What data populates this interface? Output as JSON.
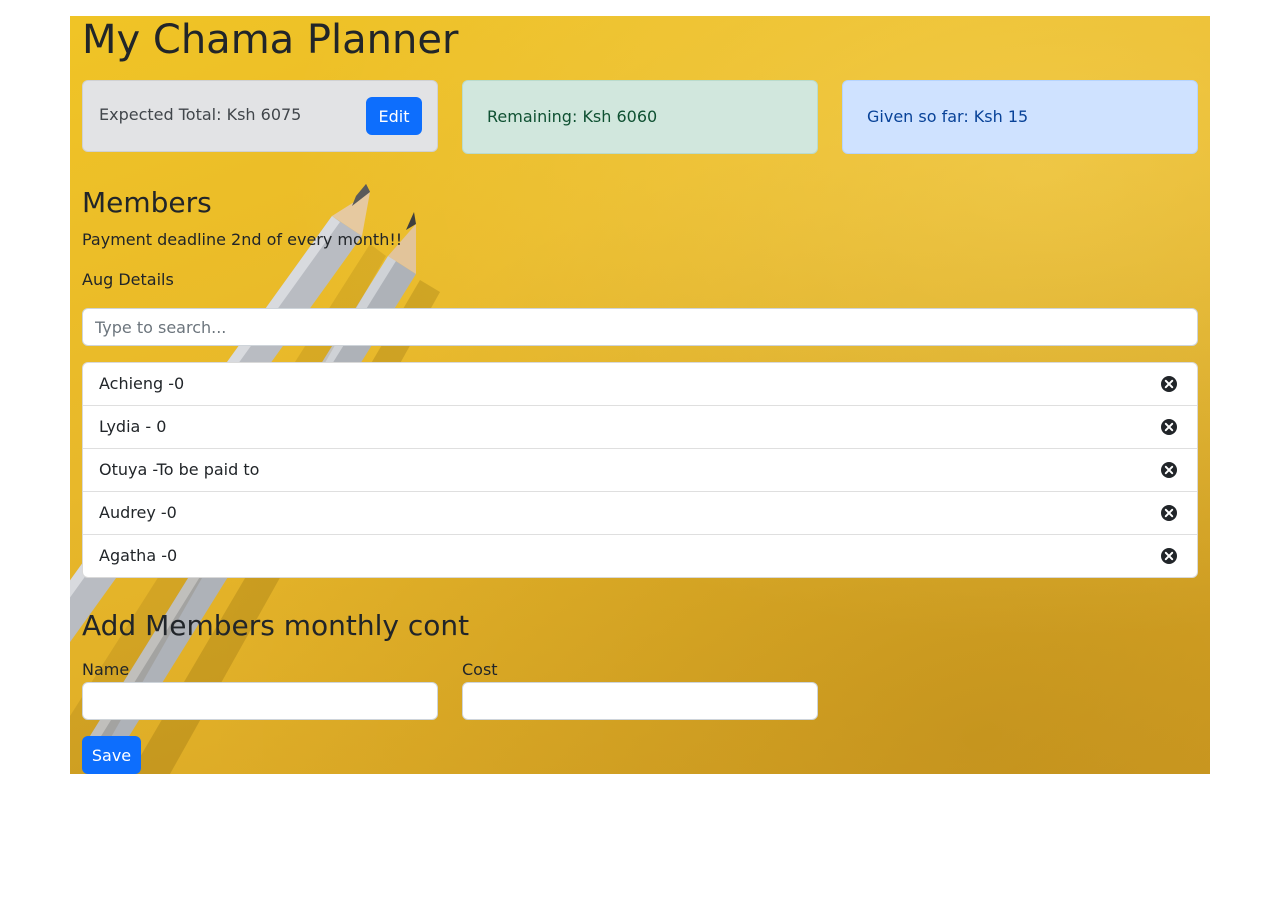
{
  "header": {
    "title": "My Chama Planner"
  },
  "summary": {
    "expected_total": "Expected Total: Ksh 6075",
    "edit_label": "Edit",
    "remaining": "Remaining: Ksh 6060",
    "given_so_far": "Given so far: Ksh 15"
  },
  "members": {
    "heading": "Members",
    "deadline_note": "Payment deadline 2nd of every month!!",
    "month_details": "Aug Details",
    "search_placeholder": "Type to search...",
    "items": [
      {
        "label": "Achieng -0"
      },
      {
        "label": "Lydia - 0"
      },
      {
        "label": "Otuya -To be paid to"
      },
      {
        "label": "Audrey -0"
      },
      {
        "label": "Agatha -0"
      }
    ]
  },
  "add_form": {
    "heading": "Add Members monthly cont",
    "name_label": "Name",
    "name_value": "",
    "cost_label": "Cost",
    "cost_value": "",
    "save_label": "Save"
  },
  "colors": {
    "primary": "#0d6efd",
    "background": "#e8b82a",
    "card_secondary": "#e2e3e5",
    "card_success": "#d1e7dd",
    "card_info": "#cfe2ff"
  },
  "icons": {
    "remove": "close-circle-icon"
  }
}
